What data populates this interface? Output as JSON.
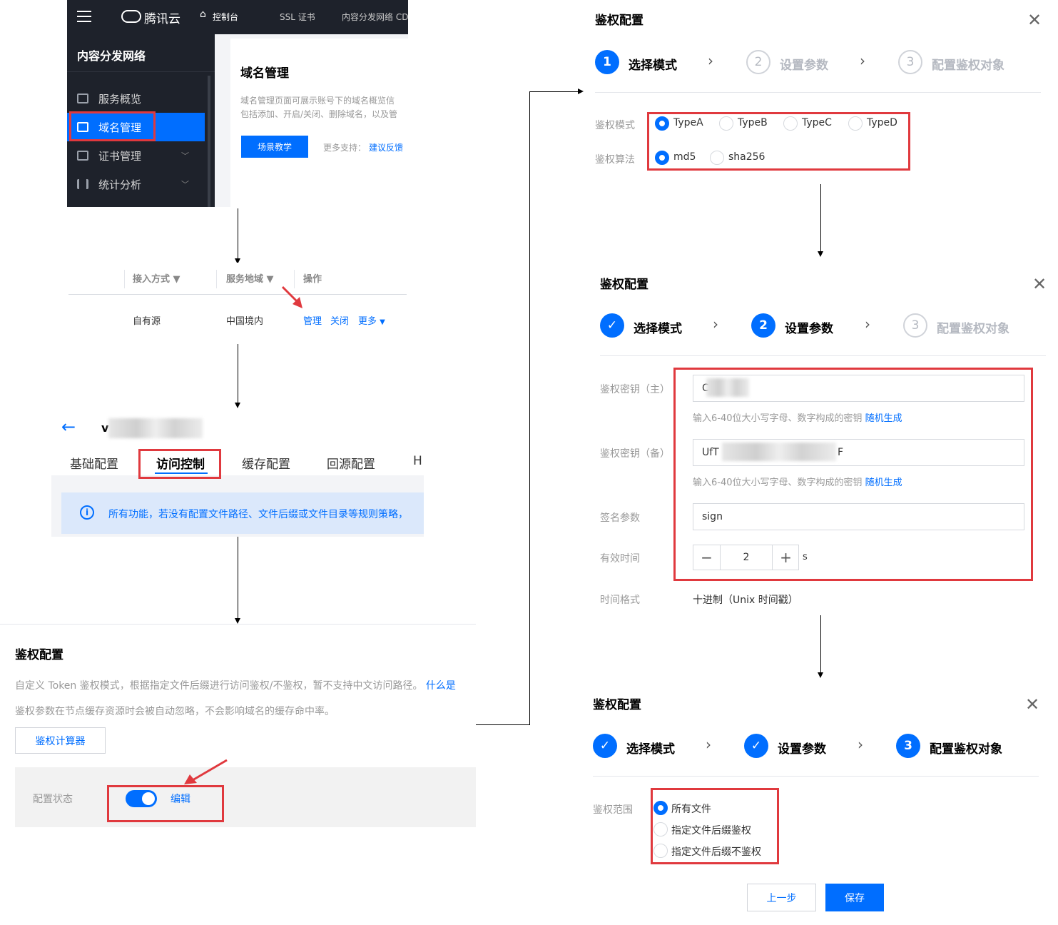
{
  "panel1": {
    "brand": "腾讯云",
    "console": "控制台",
    "nav_ssl": "SSL 证书",
    "nav_cdn": "内容分发网络 CD",
    "sidebar_title": "内容分发网络",
    "sidebar_items": [
      {
        "label": "服务概览"
      },
      {
        "label": "域名管理"
      },
      {
        "label": "证书管理"
      },
      {
        "label": "统计分析"
      }
    ],
    "page_title": "域名管理",
    "desc_line1": "域名管理页面可展示账号下的域名概览信",
    "desc_line2": "包括添加、开启/关闭、删除域名，以及管",
    "tutorial_button": "场景教学",
    "more_support": "更多支持：",
    "feedback_link": "建议反馈"
  },
  "panel2": {
    "headers": [
      "接入方式",
      "服务地域",
      "操作"
    ],
    "row": {
      "access": "自有源",
      "region": "中国境内"
    },
    "actions": [
      "管理",
      "关闭",
      "更多"
    ]
  },
  "panel3": {
    "domain_prefix": "v",
    "tabs": [
      "基础配置",
      "访问控制",
      "缓存配置",
      "回源配置",
      "H"
    ],
    "notice": "所有功能，若没有配置文件路径、文件后缀或文件目录等规则策略，"
  },
  "panel4": {
    "title": "鉴权配置",
    "desc1": "自定义 Token 鉴权模式，根据指定文件后缀进行访问鉴权/不鉴权，暂不支持中文访问路径。",
    "desc1_link": "什么是",
    "desc2": "鉴权参数在节点缓存资源时会被自动忽略，不会影响域名的缓存命中率。",
    "calc_button": "鉴权计算器",
    "status_label": "配置状态",
    "edit_link": "编辑"
  },
  "dialog1": {
    "title": "鉴权配置",
    "steps": [
      {
        "num": "1",
        "label": "选择模式"
      },
      {
        "num": "2",
        "label": "设置参数"
      },
      {
        "num": "3",
        "label": "配置鉴权对象"
      }
    ],
    "mode_label": "鉴权模式",
    "modes": [
      "TypeA",
      "TypeB",
      "TypeC",
      "TypeD"
    ],
    "algo_label": "鉴权算法",
    "algos": [
      "md5",
      "sha256"
    ]
  },
  "dialog2": {
    "title": "鉴权配置",
    "steps": [
      {
        "num": "✓",
        "label": "选择模式"
      },
      {
        "num": "2",
        "label": "设置参数"
      },
      {
        "num": "3",
        "label": "配置鉴权对象"
      }
    ],
    "key_primary_label": "鉴权密钥（主）",
    "key_primary_value": "C",
    "key_hint": "输入6-40位大小写字母、数字构成的密钥",
    "random_link": "随机生成",
    "key_backup_label": "鉴权密钥（备）",
    "key_backup_value_start": "UfT",
    "key_backup_value_end": "F",
    "sign_label": "签名参数",
    "sign_value": "sign",
    "ttl_label": "有效时间",
    "ttl_value": "2",
    "ttl_unit": "s",
    "time_format_label": "时间格式",
    "time_format_value": "十进制（Unix 时间戳）"
  },
  "dialog3": {
    "title": "鉴权配置",
    "steps": [
      {
        "num": "✓",
        "label": "选择模式"
      },
      {
        "num": "✓",
        "label": "设置参数"
      },
      {
        "num": "3",
        "label": "配置鉴权对象"
      }
    ],
    "scope_label": "鉴权范围",
    "scopes": [
      "所有文件",
      "指定文件后缀鉴权",
      "指定文件后缀不鉴权"
    ],
    "prev_button": "上一步",
    "save_button": "保存"
  },
  "colors": {
    "accent": "#006eff",
    "highlight": "#e0393e",
    "dark_nav": "#1e222b"
  }
}
